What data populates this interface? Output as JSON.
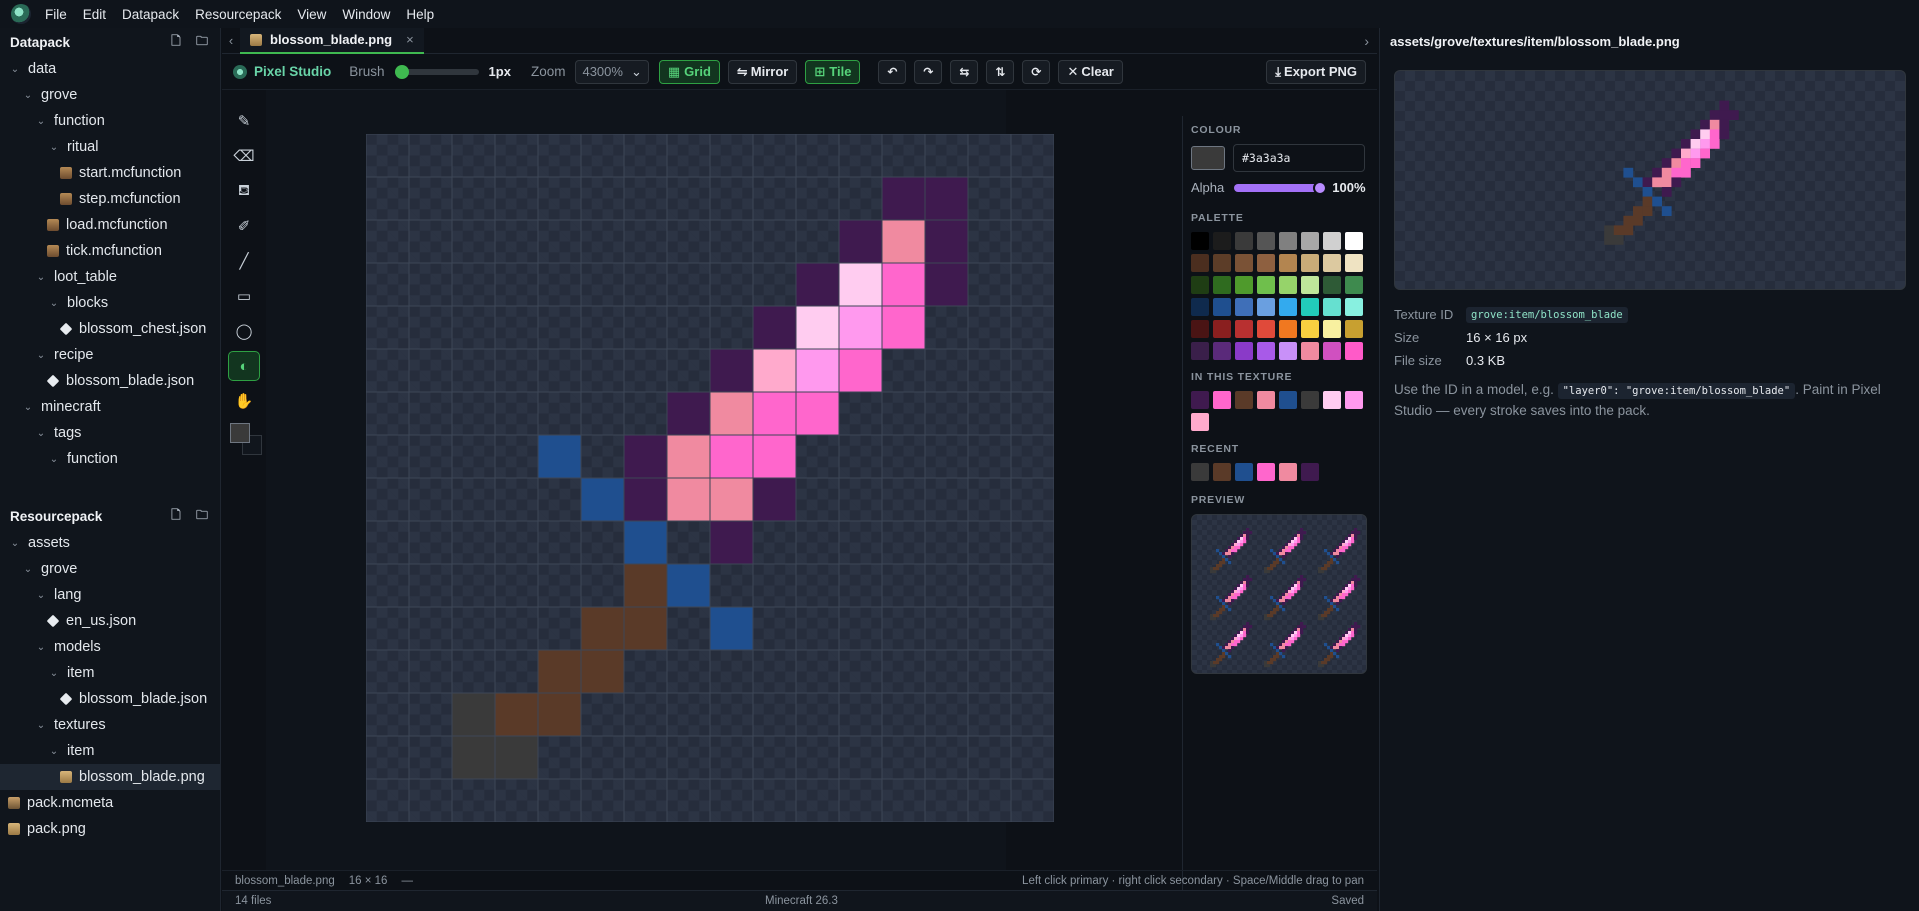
{
  "menubar": {
    "items": [
      "File",
      "Edit",
      "Datapack",
      "Resourcepack",
      "View",
      "Window",
      "Help"
    ]
  },
  "datapack": {
    "title": "Datapack",
    "tree": [
      {
        "label": "data",
        "depth": 0,
        "type": "folder"
      },
      {
        "label": "grove",
        "depth": 1,
        "type": "folder"
      },
      {
        "label": "function",
        "depth": 2,
        "type": "folder"
      },
      {
        "label": "ritual",
        "depth": 3,
        "type": "folder"
      },
      {
        "label": "start.mcfunction",
        "depth": 4,
        "type": "mcf"
      },
      {
        "label": "step.mcfunction",
        "depth": 4,
        "type": "mcf"
      },
      {
        "label": "load.mcfunction",
        "depth": 3,
        "type": "mcf"
      },
      {
        "label": "tick.mcfunction",
        "depth": 3,
        "type": "mcf"
      },
      {
        "label": "loot_table",
        "depth": 2,
        "type": "folder"
      },
      {
        "label": "blocks",
        "depth": 3,
        "type": "folder"
      },
      {
        "label": "blossom_chest.json",
        "depth": 4,
        "type": "json"
      },
      {
        "label": "recipe",
        "depth": 2,
        "type": "folder"
      },
      {
        "label": "blossom_blade.json",
        "depth": 3,
        "type": "json"
      },
      {
        "label": "minecraft",
        "depth": 1,
        "type": "folder"
      },
      {
        "label": "tags",
        "depth": 2,
        "type": "folder"
      },
      {
        "label": "function",
        "depth": 3,
        "type": "folder"
      }
    ]
  },
  "resourcepack": {
    "title": "Resourcepack",
    "tree": [
      {
        "label": "assets",
        "depth": 0,
        "type": "folder"
      },
      {
        "label": "grove",
        "depth": 1,
        "type": "folder"
      },
      {
        "label": "lang",
        "depth": 2,
        "type": "folder"
      },
      {
        "label": "en_us.json",
        "depth": 3,
        "type": "json"
      },
      {
        "label": "models",
        "depth": 2,
        "type": "folder"
      },
      {
        "label": "item",
        "depth": 3,
        "type": "folder"
      },
      {
        "label": "blossom_blade.json",
        "depth": 4,
        "type": "json"
      },
      {
        "label": "textures",
        "depth": 2,
        "type": "folder"
      },
      {
        "label": "item",
        "depth": 3,
        "type": "folder"
      },
      {
        "label": "blossom_blade.png",
        "depth": 4,
        "type": "png",
        "selected": true
      },
      {
        "label": "pack.mcmeta",
        "depth": 0,
        "type": "meta"
      },
      {
        "label": "pack.png",
        "depth": 0,
        "type": "png"
      }
    ]
  },
  "tab": {
    "label": "blossom_blade.png",
    "close": "×"
  },
  "toolbar": {
    "studio": "Pixel Studio",
    "brush_label": "Brush",
    "brush_value": "1px",
    "brush_level": 0,
    "zoom_label": "Zoom",
    "zoom_value": "4300%",
    "grid": "Grid",
    "mirror": "Mirror",
    "tile": "Tile",
    "clear": "Clear",
    "export": "Export PNG"
  },
  "props": {
    "colour_title": "COLOUR",
    "hex": "#3a3a3a",
    "alpha_label": "Alpha",
    "alpha_value": "100%",
    "palette_title": "PALETTE",
    "palette": [
      "#000000",
      "#1c1c1c",
      "#3a3a3a",
      "#555555",
      "#808080",
      "#a8a8a8",
      "#d0d0d0",
      "#ffffff",
      "#4b2e1f",
      "#5c3d28",
      "#7a5236",
      "#8e6040",
      "#b38550",
      "#c9ab78",
      "#dcc9a0",
      "#efe3c2",
      "#1f3d14",
      "#2f6b1f",
      "#4f9a2c",
      "#6fbf4c",
      "#96d36a",
      "#bfe69a",
      "#2e5a36",
      "#3e8a4e",
      "#0f2a4d",
      "#1f4f8f",
      "#3f6fb8",
      "#6a9fe0",
      "#33aaee",
      "#22ccbb",
      "#66e0d0",
      "#88f0e0",
      "#4a1414",
      "#8a1f1f",
      "#b83030",
      "#e04a3a",
      "#f07820",
      "#f8d040",
      "#f8f0a0",
      "#c8a030",
      "#3a1f4a",
      "#5a2a7a",
      "#8a3ac8",
      "#a85ae8",
      "#c890f8",
      "#f08aa0",
      "#d050c0",
      "#ff5ac8"
    ],
    "in_texture_title": "IN THIS TEXTURE",
    "in_texture": [
      "#3f1a4f",
      "#ff66cc",
      "#5a3a28",
      "#f08aa0",
      "#1f4f8f",
      "#3a3a3a",
      "#ffccf0",
      "#ff99ee",
      "#ffaacc"
    ],
    "recent_title": "RECENT",
    "recent": [
      "#3a3a3a",
      "#5a3a28",
      "#1f4f8f",
      "#ff66cc",
      "#f08aa0",
      "#3f1a4f"
    ],
    "preview_title": "PREVIEW"
  },
  "texture": {
    "legend": {
      "D": "#3f1a4f",
      "P": "#f08aa0",
      "L": "#ffccf0",
      "H": "#ff66cc",
      "V": "#ff99ee",
      "S": "#ffaacc",
      "B": "#1f4f8f",
      "R": "#5a3a28",
      "G": "#3a3a3a"
    },
    "rows": [
      "................",
      "..............D.",
      ".............DDD",
      "............DPD.",
      "...........DLHD.",
      "..........DLVH..",
      ".........DSVH...",
      "........DPHH....",
      "....B..DPHH.....",
      ".....BDPPD......",
      "......B.D.......",
      "......RB........",
      ".....RR.B.......",
      "....RR..........",
      "..GRR...........",
      "..GG............"
    ]
  },
  "canvas_texture": {
    "rows": [
      "................",
      "............DD..",
      "...........DPD..",
      "..........DLHD..",
      ".........DLVH...",
      "........DSVH....",
      ".......DPHH.....",
      "....B.DPHH......",
      ".....BDPPD......",
      "......B.D.......",
      "......RB........",
      ".....RR.B.......",
      "....RR..........",
      "..GRR...........",
      "..GG............",
      "................"
    ]
  },
  "statusline": {
    "file": "blossom_blade.png",
    "dims": "16 × 16",
    "dash": "—",
    "hint": "Left click primary · right click secondary · Space/Middle drag to pan"
  },
  "statusbar": {
    "files": "14 files",
    "version": "Minecraft 26.3",
    "saved": "Saved"
  },
  "right": {
    "path": "assets/grove/textures/item/blossom_blade.png",
    "texture_id_label": "Texture ID",
    "texture_id": "grove:item/blossom_blade",
    "size_label": "Size",
    "size": "16 × 16 px",
    "filesize_label": "File size",
    "filesize": "0.3 KB",
    "desc_pre": "Use the ID in a model, e.g.",
    "desc_code": "\"layer0\": \"grove:item/blossom_blade\"",
    "desc_post": ". Paint in Pixel Studio — every stroke saves into the pack."
  }
}
